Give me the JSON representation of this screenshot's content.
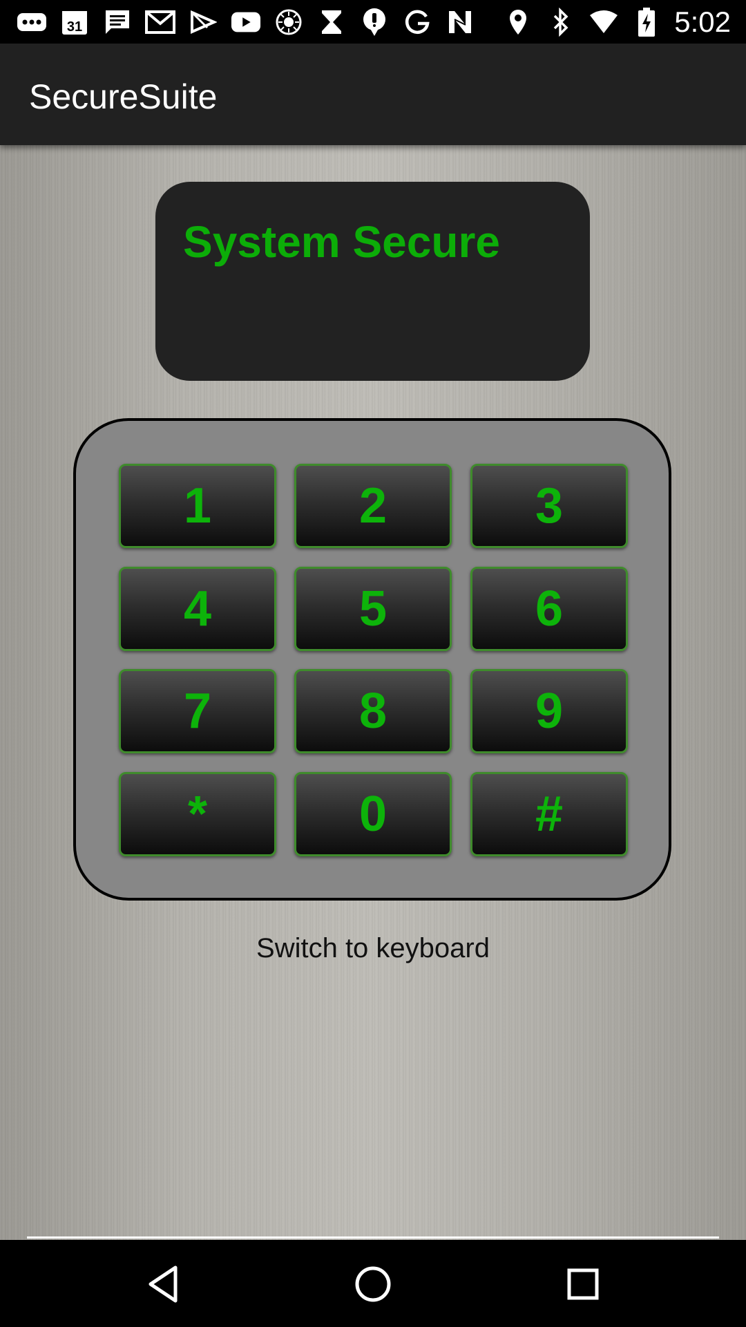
{
  "status_bar": {
    "time": "5:02",
    "calendar_day": "31",
    "left_icons": [
      "more-icon",
      "calendar-icon",
      "message-icon",
      "gmail-icon",
      "play-store-icon",
      "youtube-icon",
      "sun-icon",
      "hourglass-icon",
      "location-pin-icon",
      "google-icon",
      "n-icon"
    ],
    "right_icons": [
      "location-icon",
      "bluetooth-icon",
      "wifi-icon",
      "battery-icon"
    ]
  },
  "app_bar": {
    "title": "SecureSuite"
  },
  "display": {
    "status_text": "System Secure",
    "text_color": "#0cad08"
  },
  "keypad": {
    "keys": [
      "1",
      "2",
      "3",
      "4",
      "5",
      "6",
      "7",
      "8",
      "9",
      "*",
      "0",
      "#"
    ],
    "key_text_color": "#0db30a",
    "key_border_color": "#3f8b2c"
  },
  "switch_link": {
    "label": "Switch to keyboard"
  },
  "nav_bar": {
    "buttons": [
      "back-icon",
      "home-icon",
      "recents-icon"
    ]
  }
}
